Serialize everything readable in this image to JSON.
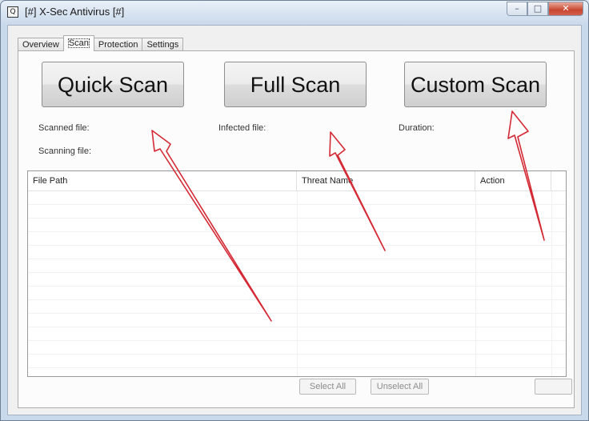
{
  "window": {
    "icon_glyph": "Q",
    "title": "[#] X-Sec Antivirus [#]",
    "controls": {
      "minimize": "–",
      "maximize": "□",
      "close": "✕"
    }
  },
  "tabs": [
    {
      "label": "Overview",
      "active": false
    },
    {
      "label": "Scan",
      "active": true
    },
    {
      "label": "Protection",
      "active": false
    },
    {
      "label": "Settings",
      "active": false
    }
  ],
  "scan": {
    "buttons": {
      "quick": "Quick Scan",
      "full": "Full Scan",
      "custom": "Custom Scan"
    },
    "status": {
      "scanned_file": "Scanned file:",
      "infected_file": "Infected file:",
      "duration": "Duration:",
      "scanning_file": "Scanning file:"
    },
    "table": {
      "columns": [
        "File Path",
        "Threat Name",
        "Action"
      ],
      "rows": []
    },
    "actions": {
      "select_all": "Select All",
      "unselect_all": "Unselect All"
    }
  },
  "annotation": {
    "arrow_color": "#d42a35"
  }
}
